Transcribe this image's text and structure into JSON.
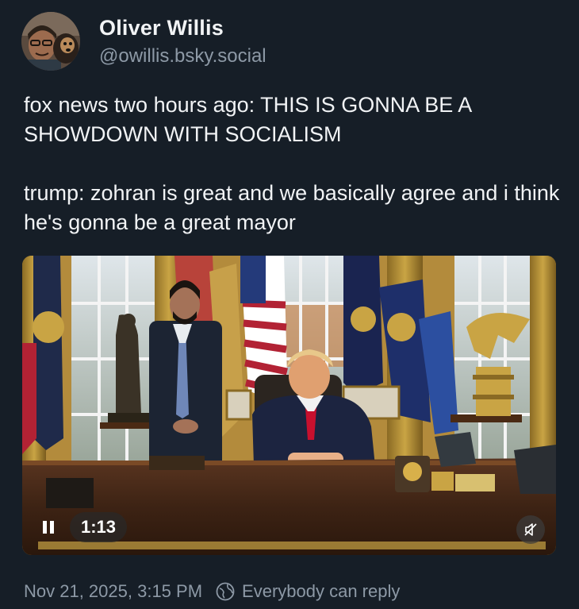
{
  "author": {
    "display_name": "Oliver Willis",
    "handle": "@owillis.bsky.social"
  },
  "post": {
    "paragraphs": [
      "fox news two hours ago: THIS IS GONNA BE A SHOWDOWN WITH SOCIALISM",
      "trump: zohran is great and we basically agree and i think he's gonna be a great mayor"
    ]
  },
  "video": {
    "duration": "1:13",
    "state_icon": "pause-icon",
    "sound_icon": "muted-speaker-icon"
  },
  "meta": {
    "timestamp": "Nov 21, 2025, 3:15 PM",
    "reply_setting": "Everybody can reply",
    "reply_icon": "globe-icon"
  },
  "colors": {
    "background": "#161e27",
    "text_primary": "#f1f3f5",
    "text_secondary": "#8d99a6"
  }
}
